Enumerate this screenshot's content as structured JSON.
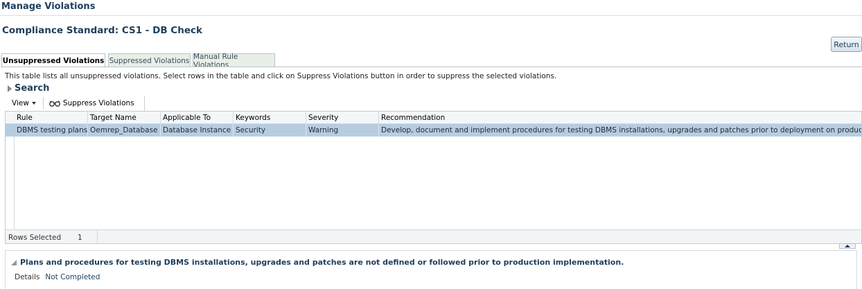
{
  "page": {
    "title": "Manage Violations",
    "standard_title": "Compliance Standard: CS1 - DB Check",
    "return_label": "Return"
  },
  "tabs": [
    {
      "label": "Unsuppressed Violations",
      "active": true
    },
    {
      "label": "Suppressed Violations",
      "active": false
    },
    {
      "label": "Manual Rule Violations",
      "active": false
    }
  ],
  "description": "This table lists all unsuppressed violations. Select rows in the table and click on Suppress Violations button in order to suppress the selected violations.",
  "search": {
    "label": "Search"
  },
  "toolbar": {
    "view_label": "View",
    "suppress_label": "Suppress Violations"
  },
  "table": {
    "columns": [
      "Rule",
      "Target Name",
      "Applicable To",
      "Keywords",
      "Severity",
      "Recommendation"
    ],
    "rows": [
      {
        "rule": "DBMS testing plans...",
        "target_name": "Oemrep_Database",
        "applicable_to": "Database Instance",
        "keywords": "Security",
        "severity": "Warning",
        "recommendation": "Develop, document and implement procedures for testing DBMS installations, upgrades and patches prior to deployment on production systems."
      }
    ],
    "status": {
      "label": "Rows Selected",
      "value": "1"
    }
  },
  "detail": {
    "title": "Plans and procedures for testing DBMS installations, upgrades and patches are not defined or followed prior to production implementation.",
    "label": "Details",
    "value": "Not Completed"
  },
  "colors": {
    "title_blue": "#1e3e5c",
    "selected_row": "#b6cde0",
    "inactive_tab": "#e8efe6"
  },
  "icons": {
    "search_toggle": "triangle-right-icon",
    "suppress": "glasses-icon",
    "detail_toggle": "triangle-expanded-icon",
    "collapse": "triangle-up-icon"
  }
}
